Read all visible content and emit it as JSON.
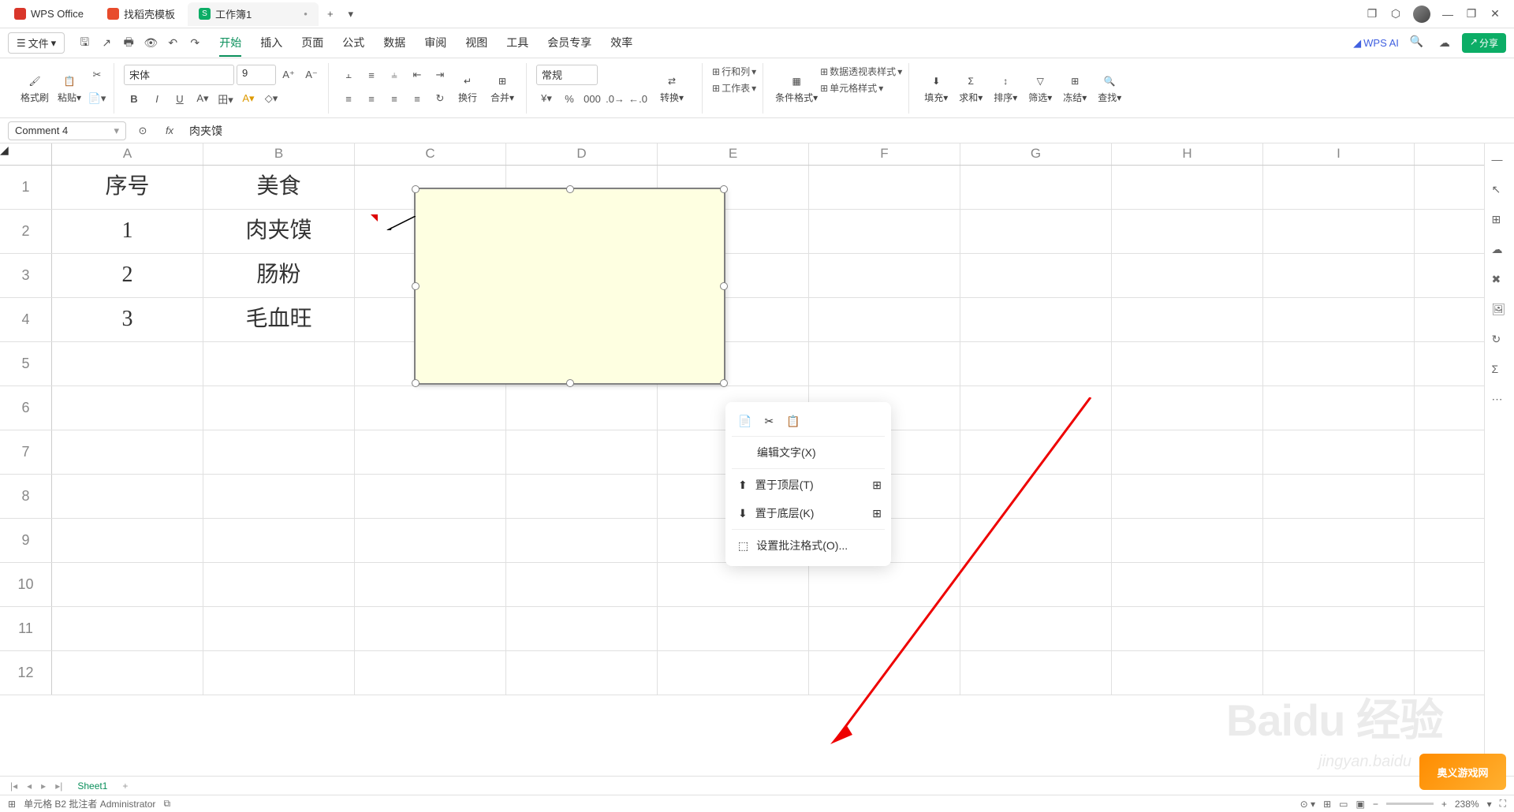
{
  "titlebar": {
    "tabs": [
      {
        "label": "WPS Office",
        "color": "#d9362a"
      },
      {
        "label": "找稻壳模板",
        "color": "#e84b2c"
      },
      {
        "label": "工作簿1",
        "color": "#0cad66",
        "active": true,
        "dirty": "•"
      }
    ],
    "add": "+"
  },
  "menubar": {
    "file": "文件",
    "tabs": [
      "开始",
      "插入",
      "页面",
      "公式",
      "数据",
      "审阅",
      "视图",
      "工具",
      "会员专享",
      "效率"
    ],
    "active_index": 0,
    "wps_ai": "WPS AI",
    "share": "分享"
  },
  "ribbon": {
    "format_painter": "格式刷",
    "paste": "粘贴",
    "font": "宋体",
    "size": "9",
    "bold": "B",
    "italic": "I",
    "underline": "U",
    "wrap": "换行",
    "merge": "合并",
    "numfmt": "常规",
    "convert": "转换",
    "rowcol": "行和列",
    "worksheet": "工作表",
    "condfmt": "条件格式",
    "pivot": "数据透视表样式",
    "cellstyle": "单元格样式",
    "fill": "填充",
    "sum": "求和",
    "sort": "排序",
    "filter": "筛选",
    "freeze": "冻结",
    "find": "查找"
  },
  "formula_bar": {
    "name": "Comment 4",
    "fx": "肉夹馍"
  },
  "columns": [
    "A",
    "B",
    "C",
    "D",
    "E",
    "F",
    "G",
    "H",
    "I"
  ],
  "rows": [
    "1",
    "2",
    "3",
    "4",
    "5",
    "6",
    "7",
    "8",
    "9",
    "10",
    "11",
    "12"
  ],
  "data": {
    "A1": "序号",
    "B1": "美食",
    "A2": "1",
    "B2": "肉夹馍",
    "A3": "2",
    "B3": "肠粉",
    "A4": "3",
    "B4": "毛血旺"
  },
  "context_menu": {
    "edit_text": "编辑文字(X)",
    "bring_front": "置于顶层(T)",
    "send_back": "置于底层(K)",
    "format_comment": "设置批注格式(O)..."
  },
  "sheet_tab": "Sheet1",
  "statusbar": {
    "cell_info": "单元格 B2 批注者 Administrator",
    "zoom": "238%"
  },
  "watermark": "Baidu 经验",
  "watermark_sub": "jingyan.baidu",
  "corner_brand": "奥义游戏网"
}
